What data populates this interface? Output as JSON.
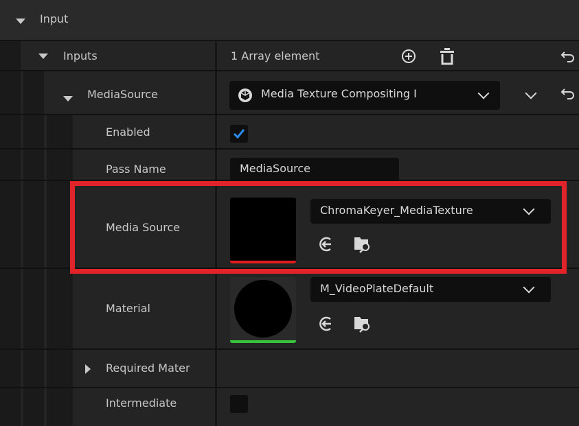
{
  "sections": {
    "input": {
      "label": "Input"
    },
    "inputs": {
      "label": "Inputs",
      "value": "1 Array element"
    },
    "media_source_group": {
      "label": "MediaSource",
      "value": "Media Texture Compositing I"
    },
    "enabled": {
      "label": "Enabled",
      "checked": true
    },
    "pass_name": {
      "label": "Pass Name",
      "value": "MediaSource"
    },
    "media_source": {
      "label": "Media Source",
      "asset": "ChromaKeyer_MediaTexture"
    },
    "material": {
      "label": "Material",
      "asset": "M_VideoPlateDefault"
    },
    "required_materials": {
      "label": "Required Mater"
    },
    "intermediate": {
      "label": "Intermediate",
      "checked": false
    }
  },
  "colors": {
    "highlight_box": "#e0242a",
    "checkbox_check": "#2b8cf0",
    "media_source_thumb_bar": "#e01c1c",
    "material_thumb_bar": "#39c23d"
  },
  "icons": {
    "add": "add-element-icon",
    "delete": "delete-all-icon",
    "reset": "reset-to-default-icon",
    "use_selected": "use-selected-asset-icon",
    "browse": "browse-to-asset-icon",
    "class": "class-icon"
  }
}
